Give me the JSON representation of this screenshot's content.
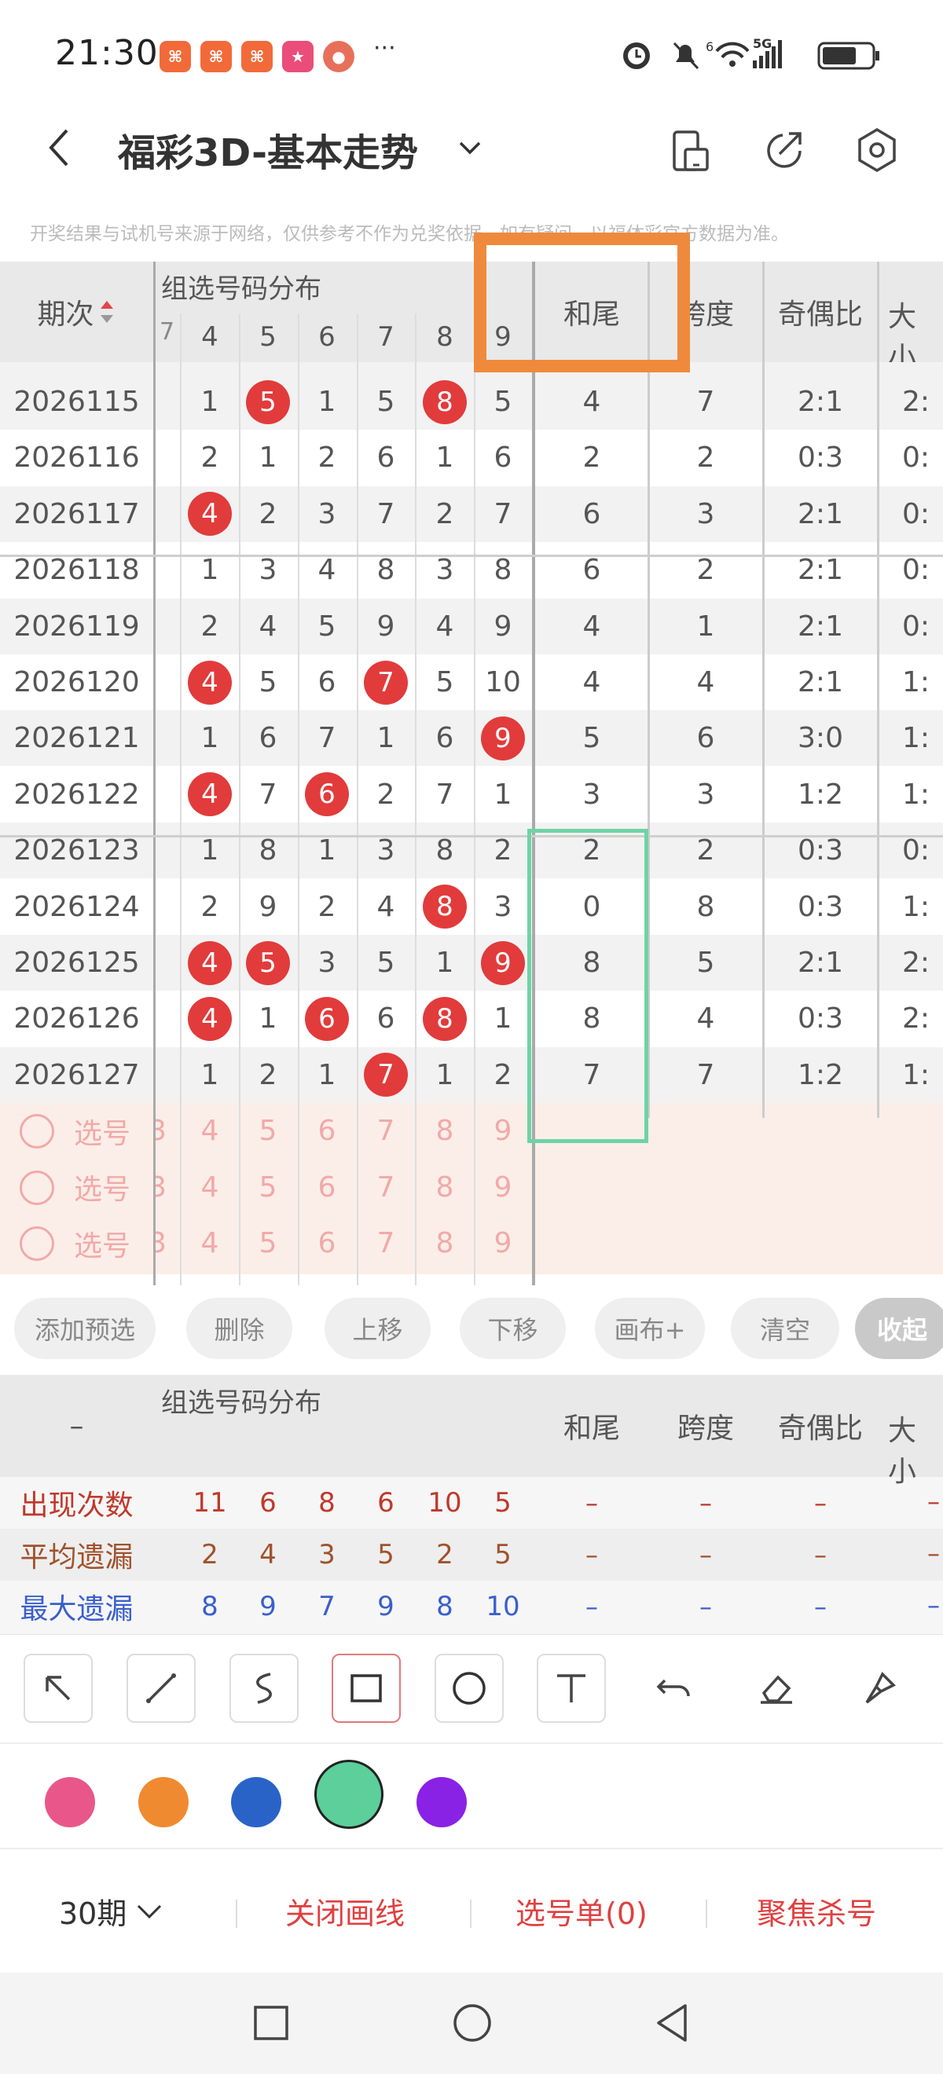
{
  "status_bar": {
    "time": "21:30",
    "app_icons": [
      "xiaohongshu-icon",
      "xiaohongshu-icon",
      "xiaohongshu-icon",
      "game-icon",
      "sphere-icon"
    ],
    "more": "···",
    "network": "5G",
    "signal_small": "6"
  },
  "header": {
    "title": "福彩3D-基本走势"
  },
  "disclaimer": "开奖结果与试机号来源于网络，仅供参考不作为兑奖依据，如有疑问，以福体彩官方数据为准。",
  "table": {
    "col_period": "期次",
    "group_title": "组选号码分布",
    "digits": [
      "4",
      "5",
      "6",
      "7",
      "8",
      "9"
    ],
    "col_hewei": "和尾",
    "col_kuadu": "跨度",
    "col_jiou": "奇偶比",
    "col_daxiao": "大小",
    "rows": [
      {
        "period": "2026115",
        "d": [
          "1",
          "5",
          "1",
          "5",
          "8",
          "5"
        ],
        "balls": [
          1,
          4
        ],
        "hewei": "4",
        "kuadu": "7",
        "jiou": "2:1",
        "daxiao": "2:"
      },
      {
        "period": "2026116",
        "d": [
          "2",
          "1",
          "2",
          "6",
          "1",
          "6"
        ],
        "balls": [],
        "hewei": "2",
        "kuadu": "2",
        "jiou": "0:3",
        "daxiao": "0:"
      },
      {
        "period": "2026117",
        "d": [
          "4",
          "2",
          "3",
          "7",
          "2",
          "7"
        ],
        "balls": [
          0
        ],
        "hewei": "6",
        "kuadu": "3",
        "jiou": "2:1",
        "daxiao": "0:"
      },
      {
        "period": "2026118",
        "d": [
          "1",
          "3",
          "4",
          "8",
          "3",
          "8"
        ],
        "balls": [],
        "hewei": "6",
        "kuadu": "2",
        "jiou": "2:1",
        "daxiao": "0:"
      },
      {
        "period": "2026119",
        "d": [
          "2",
          "4",
          "5",
          "9",
          "4",
          "9"
        ],
        "balls": [],
        "hewei": "4",
        "kuadu": "1",
        "jiou": "2:1",
        "daxiao": "0:"
      },
      {
        "period": "2026120",
        "d": [
          "4",
          "5",
          "6",
          "7",
          "5",
          "10"
        ],
        "balls": [
          0,
          3
        ],
        "hewei": "4",
        "kuadu": "4",
        "jiou": "2:1",
        "daxiao": "1:"
      },
      {
        "period": "2026121",
        "d": [
          "1",
          "6",
          "7",
          "1",
          "6",
          "9"
        ],
        "balls": [
          5
        ],
        "hewei": "5",
        "kuadu": "6",
        "jiou": "3:0",
        "daxiao": "1:"
      },
      {
        "period": "2026122",
        "d": [
          "4",
          "7",
          "6",
          "2",
          "7",
          "1"
        ],
        "balls": [
          0,
          2
        ],
        "hewei": "3",
        "kuadu": "3",
        "jiou": "1:2",
        "daxiao": "1:"
      },
      {
        "period": "2026123",
        "d": [
          "1",
          "8",
          "1",
          "3",
          "8",
          "2"
        ],
        "balls": [],
        "hewei": "2",
        "kuadu": "2",
        "jiou": "0:3",
        "daxiao": "0:"
      },
      {
        "period": "2026124",
        "d": [
          "2",
          "9",
          "2",
          "4",
          "8",
          "3"
        ],
        "balls": [
          4
        ],
        "hewei": "0",
        "kuadu": "8",
        "jiou": "0:3",
        "daxiao": "1:"
      },
      {
        "period": "2026125",
        "d": [
          "4",
          "5",
          "3",
          "5",
          "1",
          "9"
        ],
        "balls": [
          0,
          1,
          5
        ],
        "hewei": "8",
        "kuadu": "5",
        "jiou": "2:1",
        "daxiao": "2:"
      },
      {
        "period": "2026126",
        "d": [
          "4",
          "1",
          "6",
          "6",
          "8",
          "1"
        ],
        "balls": [
          0,
          2,
          4
        ],
        "hewei": "8",
        "kuadu": "4",
        "jiou": "0:3",
        "daxiao": "2:"
      },
      {
        "period": "2026127",
        "d": [
          "1",
          "2",
          "1",
          "7",
          "1",
          "2"
        ],
        "balls": [
          3
        ],
        "hewei": "7",
        "kuadu": "7",
        "jiou": "1:2",
        "daxiao": "1:"
      }
    ],
    "pick_label": "选号",
    "pick_partial": "3"
  },
  "actions": [
    "添加预选",
    "删除",
    "上移",
    "下移",
    "画布+",
    "清空",
    "收起"
  ],
  "stats": {
    "dash": "–",
    "rows": [
      {
        "label": "出现次数",
        "values": [
          "11",
          "6",
          "8",
          "6",
          "10",
          "5"
        ],
        "color": "#c0392b"
      },
      {
        "label": "平均遗漏",
        "values": [
          "2",
          "4",
          "3",
          "5",
          "2",
          "5"
        ],
        "color": "#a0522d"
      },
      {
        "label": "最大遗漏",
        "values": [
          "8",
          "9",
          "7",
          "9",
          "8",
          "10"
        ],
        "color": "#3a5fcd"
      }
    ]
  },
  "tools": [
    "arrow-tool-icon",
    "line-tool-icon",
    "curve-tool-icon",
    "rectangle-tool-icon",
    "circle-tool-icon",
    "text-tool-icon",
    "undo-icon",
    "eraser-icon",
    "brush-icon"
  ],
  "colors": [
    "#e9578a",
    "#f08a30",
    "#2a63c8",
    "#5ccf9a",
    "#8a22e6"
  ],
  "bottom": {
    "periods": "30期",
    "close_lines": "关闭画线",
    "pick_list": "选号单(0)",
    "focus_kill": "聚焦杀号"
  },
  "annotations": {
    "orange_rect": "#ef8a3c",
    "green_rect": "#6ed3a6"
  }
}
